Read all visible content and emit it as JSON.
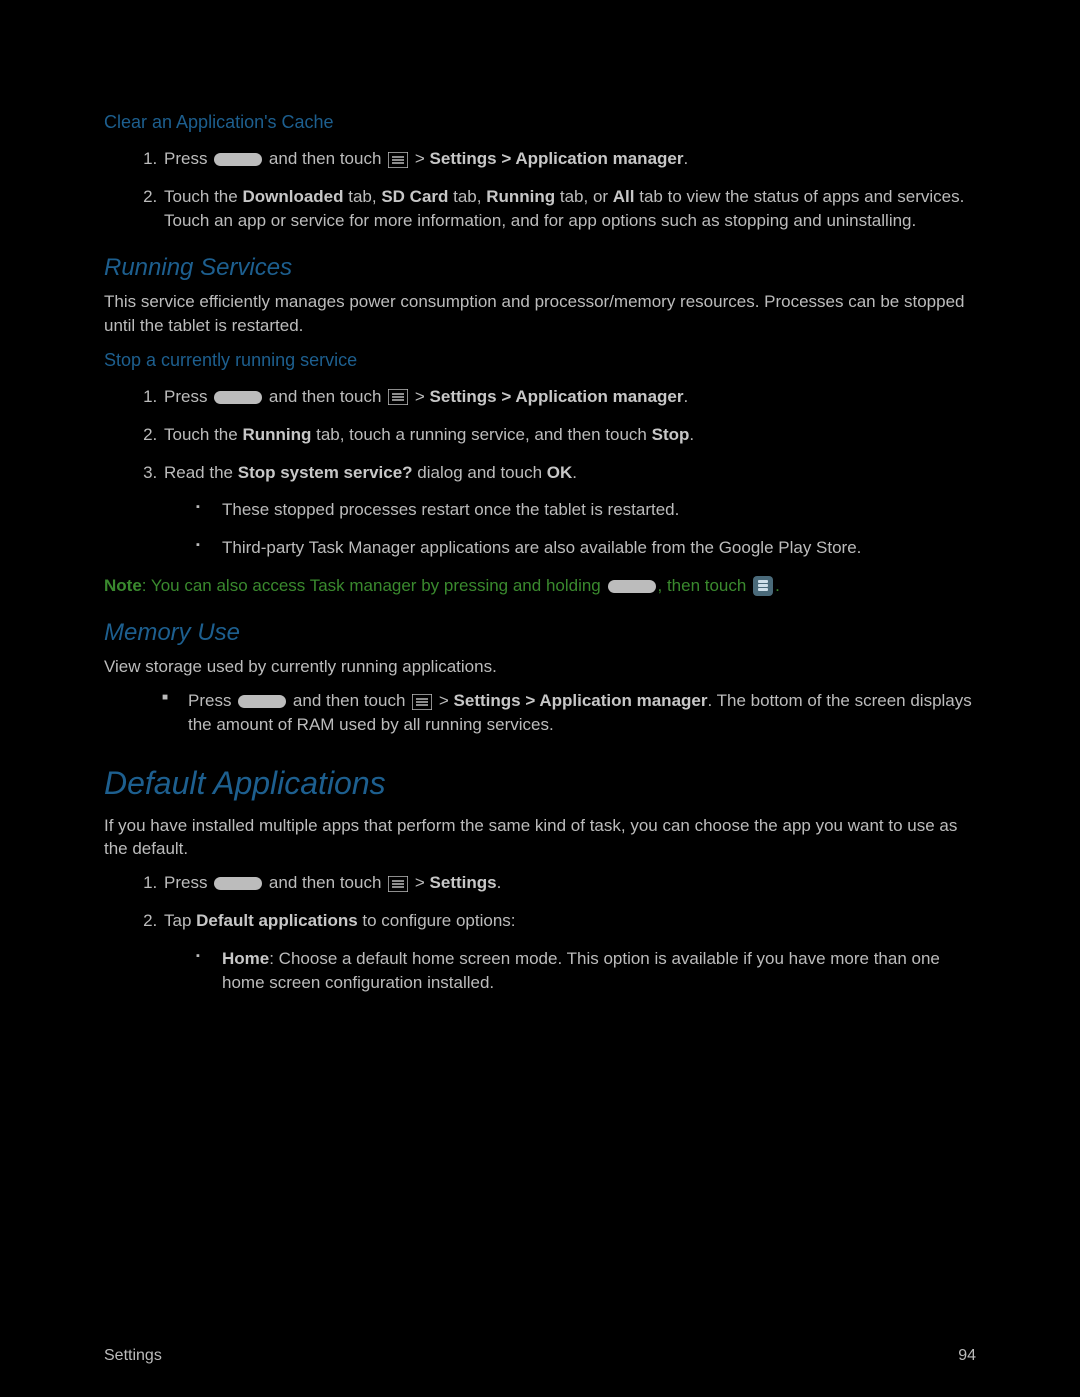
{
  "clear_cache": {
    "heading": "Clear an Application's Cache",
    "step1_a": "Press ",
    "step1_b": " and then touch ",
    "step1_c": " > ",
    "step1_d": "Settings > Application manager",
    "step1_e": ".",
    "step2_a": "Touch the ",
    "step2_b": "Downloaded",
    "step2_c": " tab, ",
    "step2_d": "SD Card",
    "step2_e": " tab, ",
    "step2_f": "Running",
    "step2_g": " tab, or ",
    "step2_h": "All",
    "step2_i": " tab to view the status of apps and services. Touch an app or service for more information, and for app options such as stopping and uninstalling."
  },
  "running_services": {
    "heading": "Running Services",
    "body": "This service efficiently manages power consumption and processor/memory resources. Processes can be stopped until the tablet is restarted.",
    "sub_heading": "Stop a currently running service",
    "step1_a": "Press ",
    "step1_b": " and then touch ",
    "step1_c": " > ",
    "step1_d": "Settings > Application manager",
    "step1_e": ".",
    "step2_a": "Touch the ",
    "step2_b": "Running",
    "step2_c": " tab, touch a running service, and then touch ",
    "step2_d": "Stop",
    "step2_e": ".",
    "step3_a": "Read the ",
    "step3_b": "Stop system service?",
    "step3_c": " dialog and touch ",
    "step3_d": "OK",
    "step3_e": ".",
    "sub1": "These stopped processes restart once the tablet is restarted.",
    "sub2": "Third-party Task Manager applications are also available from the Google Play Store.",
    "note_label": "Note",
    "note_a": ": You can also access Task manager by pressing and holding ",
    "note_b": ", then touch ",
    "note_c": "."
  },
  "memory_use": {
    "heading": "Memory Use",
    "body": "View storage used by currently running applications.",
    "step_a": "Press ",
    "step_b": " and then touch ",
    "step_c": " > ",
    "step_d": "Settings > Application manager",
    "step_e": ". The bottom of the screen displays the amount of RAM used by all running services."
  },
  "default_apps": {
    "heading": "Default Applications",
    "body": "If you have installed multiple apps that perform the same kind of task, you can choose the app you want to use as the default.",
    "step1_a": "Press ",
    "step1_b": " and then touch ",
    "step1_c": " > ",
    "step1_d": "Settings",
    "step1_e": ".",
    "step2_a": "Tap ",
    "step2_b": "Default applications",
    "step2_c": " to configure options:",
    "sub_b": "Home",
    "sub_c": ": Choose a default home screen mode. This option is available if you have more than one home screen configuration installed."
  },
  "footer": {
    "left": "Settings",
    "right": "94"
  }
}
